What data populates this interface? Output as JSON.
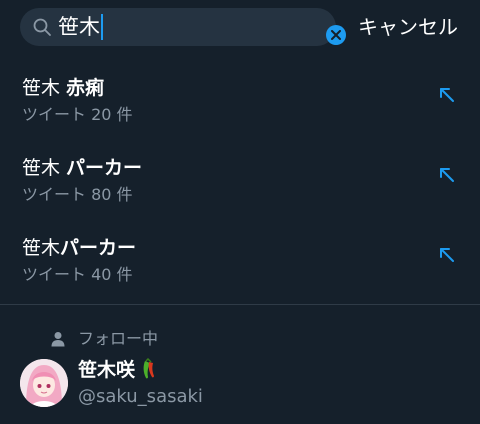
{
  "search": {
    "query": "笹木",
    "cancel_label": "キャンセル"
  },
  "suggestions": [
    {
      "prefix": "笹木 ",
      "bold": "赤痢",
      "count": "ツイート 20 件"
    },
    {
      "prefix": "笹木 ",
      "bold": "パーカー",
      "count": "ツイート 80 件"
    },
    {
      "prefix": "笹木",
      "bold": "パーカー",
      "count": "ツイート 40 件"
    }
  ],
  "following": {
    "label": "フォロー中",
    "user": {
      "name": "笹木咲",
      "handle": "@saku_sasaki"
    }
  },
  "colors": {
    "background": "#15202b",
    "accent": "#1d9bf0",
    "secondary_text": "#8b98a5"
  },
  "icons": [
    "search-icon",
    "clear-icon",
    "arrow-up-left-icon",
    "person-icon"
  ]
}
